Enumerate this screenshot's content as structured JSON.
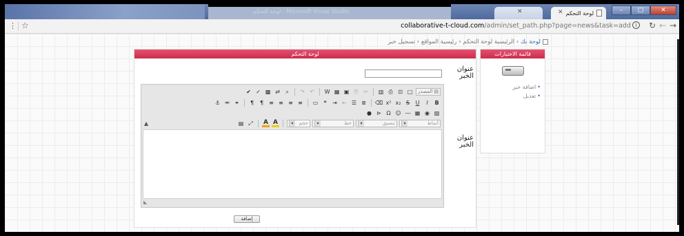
{
  "browser": {
    "window_title": "لوحة التحكم - Microsoft Visual Studio",
    "tabs": [
      {
        "label": "",
        "active": false
      },
      {
        "label": "لوحة التحكم",
        "active": true
      }
    ],
    "url": {
      "host": "collaborative-t-cloud.com",
      "path": "/admin/set_path.php?page=news&task=add"
    },
    "window_controls": {
      "minimize": "–",
      "maximize": "□",
      "close": "✕"
    }
  },
  "page": {
    "breadcrumb": {
      "home": "لوحة ٮك",
      "trail": "الرئيسية لوحة التحكم ‹ رئيسية المواقع ‹ تسجيل خبر"
    },
    "sidebar": {
      "header": "قائمة الاختيارات",
      "links": [
        "اضافة خبر",
        "تعديل"
      ]
    },
    "main": {
      "header": "لوحة التحكم",
      "title_label": "عنوان الخبر",
      "title_value": "",
      "body_label": "عنوان الخبر",
      "source_button": "المصدر",
      "combos": {
        "styles": "أنماط",
        "format": "تنسيق",
        "font": "خط",
        "size": "حجم"
      },
      "submit_label": "إضافة"
    }
  }
}
